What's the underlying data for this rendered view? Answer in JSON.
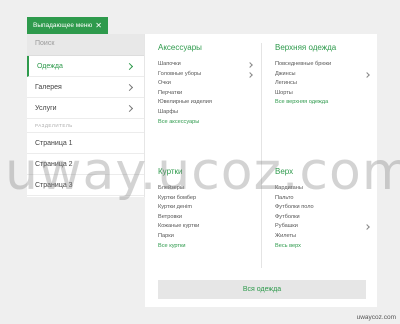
{
  "dropdown_button": {
    "label": "Выпадающее меню",
    "close_glyph": "✕"
  },
  "sidebar": {
    "search_placeholder": "Поиск",
    "items": [
      {
        "label": "Одежда",
        "has_submenu": true,
        "active": true
      },
      {
        "label": "Галерея",
        "has_submenu": true,
        "active": false
      },
      {
        "label": "Услуги",
        "has_submenu": true,
        "active": false
      }
    ],
    "divider_label": "РАЗДЕЛИТЕЛЬ",
    "pages": [
      {
        "label": "Страница 1"
      },
      {
        "label": "Страница 2"
      },
      {
        "label": "Страница 3"
      }
    ]
  },
  "mega_menu": {
    "accessories": {
      "title": "Аксессуары",
      "items": [
        "Шапочки",
        "Головные уборы",
        "Очки",
        "Перчатки",
        "Ювелирные изделия",
        "Шарфы"
      ],
      "all_link": "Все аксессуары"
    },
    "outerwear": {
      "title": "Верхняя одежда",
      "items": [
        "Повседневные брюки",
        "Джинсы",
        "Легинсы",
        "Шорты"
      ],
      "all_link": "Все верхняя одежда"
    },
    "jackets": {
      "title": "Куртки",
      "items": [
        "Блейзеры",
        "Куртки бомбер",
        "Куртки денim",
        "Ветровки",
        "Кожаные куртки",
        "Парки"
      ],
      "all_link": "Все куртки"
    },
    "tops": {
      "title": "Верх",
      "items": [
        "Кардиганы",
        "Пальто",
        "Футболки поло",
        "Футболки",
        "Рубашки",
        "Жилеты"
      ],
      "all_link": "Весь верх"
    },
    "all_button": "Вся одежда"
  },
  "watermark": "uway.ucoz.com",
  "credit": "uwaycoz.com",
  "colors": {
    "accent": "#2e9a4c",
    "background": "#efefef",
    "panel": "#ffffff"
  }
}
